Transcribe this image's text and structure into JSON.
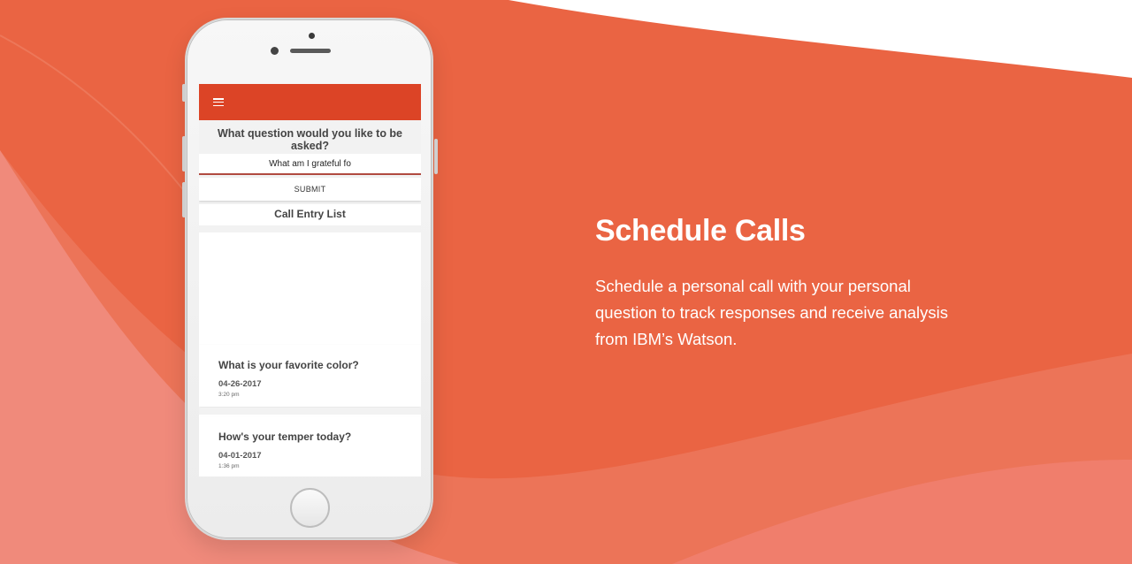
{
  "colors": {
    "background_main": "#ea6443",
    "background_light": "#f08a7b",
    "app_bar": "#dc4426",
    "text_on_bg": "#ffffff"
  },
  "phone": {
    "app_bar": {
      "menu_icon": "hamburger-menu-icon"
    },
    "question_label": "What question would you like to be asked?",
    "input": {
      "value": "What am I grateful fo"
    },
    "submit_label": "SUBMIT",
    "list_title": "Call Entry List",
    "entries": [
      {
        "question": "What is your favorite color?",
        "date": "04-26-2017",
        "time": "3:20 pm"
      },
      {
        "question": "How's your temper today?",
        "date": "04-01-2017",
        "time": "1:36 pm"
      }
    ]
  },
  "feature": {
    "title": "Schedule Calls",
    "description": "Schedule a personal call with your personal question to track responses and receive analysis from IBM’s Watson."
  }
}
